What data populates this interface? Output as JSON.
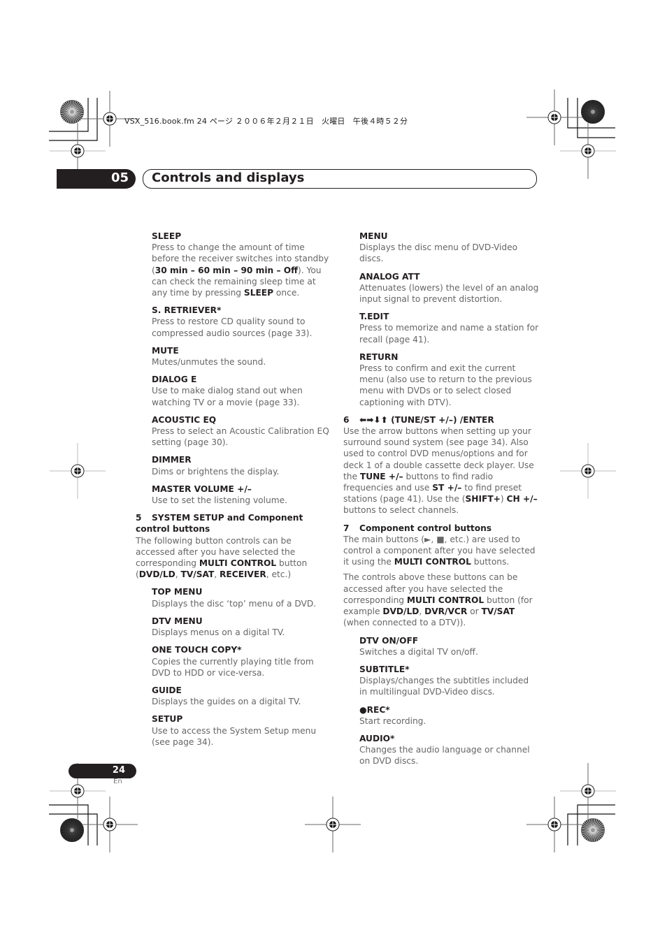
{
  "print_header": "VSX_516.book.fm  24 ページ  ２００６年２月２１日　火曜日　午後４時５２分",
  "chapter": {
    "number": "05",
    "title": "Controls and displays"
  },
  "left_column": {
    "items_top": [
      {
        "heading": "SLEEP",
        "html": "Press to change the amount of time before the receiver switches into standby (<b>30 min – 60 min – 90 min – Off</b>). You can check the remaining sleep time at any time by pressing <b>SLEEP</b> once."
      },
      {
        "heading": "S. RETRIEVER*",
        "html": "Press to restore CD quality sound to compressed audio sources (page 33)."
      },
      {
        "heading": "MUTE",
        "html": "Mutes/unmutes the sound."
      },
      {
        "heading": "DIALOG E",
        "html": "Use to make dialog stand out when watching TV or a movie (page 33)."
      },
      {
        "heading": "ACOUSTIC EQ",
        "html": "Press to select an Acoustic Calibration EQ setting (page 30)."
      },
      {
        "heading": "DIMMER",
        "html": "Dims or brightens the display."
      },
      {
        "heading": "MASTER VOLUME +/–",
        "html": "Use to set the listening volume."
      }
    ],
    "section5": {
      "number": "5",
      "heading": "SYSTEM SETUP and Component control buttons",
      "paragraphs": [
        "The following button controls can be accessed after you have selected the corresponding <b>MULTI CONTROL</b> button (<b>DVD/LD</b>, <b>TV/SAT</b>, <b>RECEIVER</b>, etc.)"
      ]
    },
    "items_bottom": [
      {
        "heading": "TOP MENU",
        "html": "Displays the disc ‘top’ menu of a DVD."
      },
      {
        "heading": "DTV MENU",
        "html": "Displays menus on a digital TV."
      },
      {
        "heading": "ONE TOUCH COPY*",
        "html": "Copies the currently playing title from DVD to HDD or vice-versa."
      },
      {
        "heading": "GUIDE",
        "html": "Displays the guides on a digital TV."
      },
      {
        "heading": "SETUP",
        "html": "Use to access the System Setup menu (see page 34)."
      }
    ]
  },
  "right_column": {
    "items_top": [
      {
        "heading": "MENU",
        "html": "Displays the disc menu of DVD-Video discs."
      },
      {
        "heading": "ANALOG ATT",
        "html": "Attenuates (lowers) the level of an analog input signal to prevent distortion."
      },
      {
        "heading": "T.EDIT",
        "html": "Press to memorize and name a station for recall (page 41)."
      },
      {
        "heading": "RETURN",
        "html": "Press to confirm and exit the current menu (also use to return to the previous menu with DVDs or to select closed captioning with DTV)."
      }
    ],
    "section6": {
      "number": "6",
      "heading": "⬅➡⬇⬆ (TUNE/ST +/–) /ENTER",
      "paragraphs": [
        "Use the arrow buttons when setting up your surround sound system (see page 34). Also used to control DVD menus/options and for deck 1 of a double cassette deck player. Use the <b>TUNE +/–</b> buttons to find radio frequencies and use <b>ST +/–</b> to find preset stations (page 41). Use the (<b>SHIFT+</b>) <b>CH +/–</b> buttons to select channels."
      ]
    },
    "section7": {
      "number": "7",
      "heading": "Component control buttons",
      "paragraphs": [
        "The main buttons (►, ■, etc.) are used to control a component after you have selected it using the <b>MULTI CONTROL</b> buttons.",
        "The controls above these buttons can be accessed after you have selected the corresponding <b>MULTI CONTROL</b> button (for example <b>DVD/LD</b>, <b>DVR/VCR</b> or <b>TV/SAT</b> (when connected to a DTV))."
      ]
    },
    "items_bottom": [
      {
        "heading": "DTV ON/OFF",
        "html": "Switches a digital TV on/off."
      },
      {
        "heading": "SUBTITLE*",
        "html": "Displays/changes the subtitles included in multilingual DVD-Video discs."
      },
      {
        "heading": "●REC*",
        "html": "Start recording."
      },
      {
        "heading": "AUDIO*",
        "html": "Changes the audio language or channel on DVD discs."
      }
    ]
  },
  "footer": {
    "page_number": "24",
    "language": "En"
  }
}
